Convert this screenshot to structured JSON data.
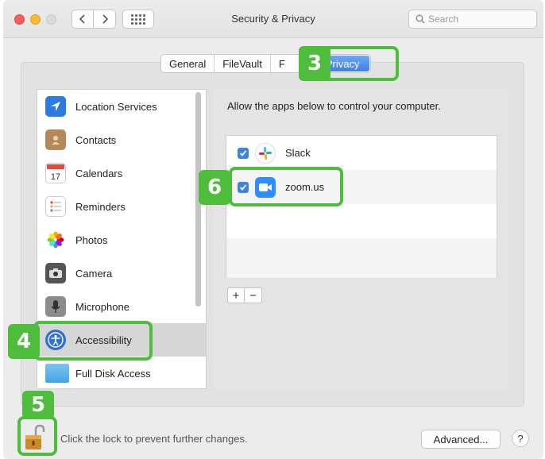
{
  "window": {
    "title": "Security & Privacy"
  },
  "search": {
    "placeholder": "Search"
  },
  "tabs": [
    {
      "label": "General"
    },
    {
      "label": "FileVault"
    },
    {
      "label": "F"
    },
    {
      "label": "Privacy",
      "active": true
    }
  ],
  "sidebar": {
    "items": [
      {
        "label": "Location Services",
        "icon": "location-arrow-icon"
      },
      {
        "label": "Contacts",
        "icon": "contacts-book-icon"
      },
      {
        "label": "Calendars",
        "icon": "calendar-icon"
      },
      {
        "label": "Reminders",
        "icon": "reminders-list-icon"
      },
      {
        "label": "Photos",
        "icon": "photos-flower-icon"
      },
      {
        "label": "Camera",
        "icon": "camera-icon"
      },
      {
        "label": "Microphone",
        "icon": "microphone-icon"
      },
      {
        "label": "Accessibility",
        "icon": "accessibility-icon",
        "selected": true
      },
      {
        "label": "Full Disk Access",
        "icon": "folder-icon"
      }
    ]
  },
  "main": {
    "description": "Allow the apps below to control your computer.",
    "apps": [
      {
        "name": "Slack",
        "checked": true,
        "icon": "slack-icon"
      },
      {
        "name": "zoom.us",
        "checked": true,
        "icon": "zoom-icon"
      }
    ],
    "add_label": "+",
    "remove_label": "−"
  },
  "footer": {
    "lock_text": "Click the lock to prevent further changes.",
    "advanced_label": "Advanced...",
    "help_label": "?"
  },
  "callouts": {
    "privacy": "3",
    "accessibility": "4",
    "lock": "5",
    "zoom": "6"
  },
  "colors": {
    "highlight": "#4fbd3c",
    "accent": "#3d82e6"
  }
}
